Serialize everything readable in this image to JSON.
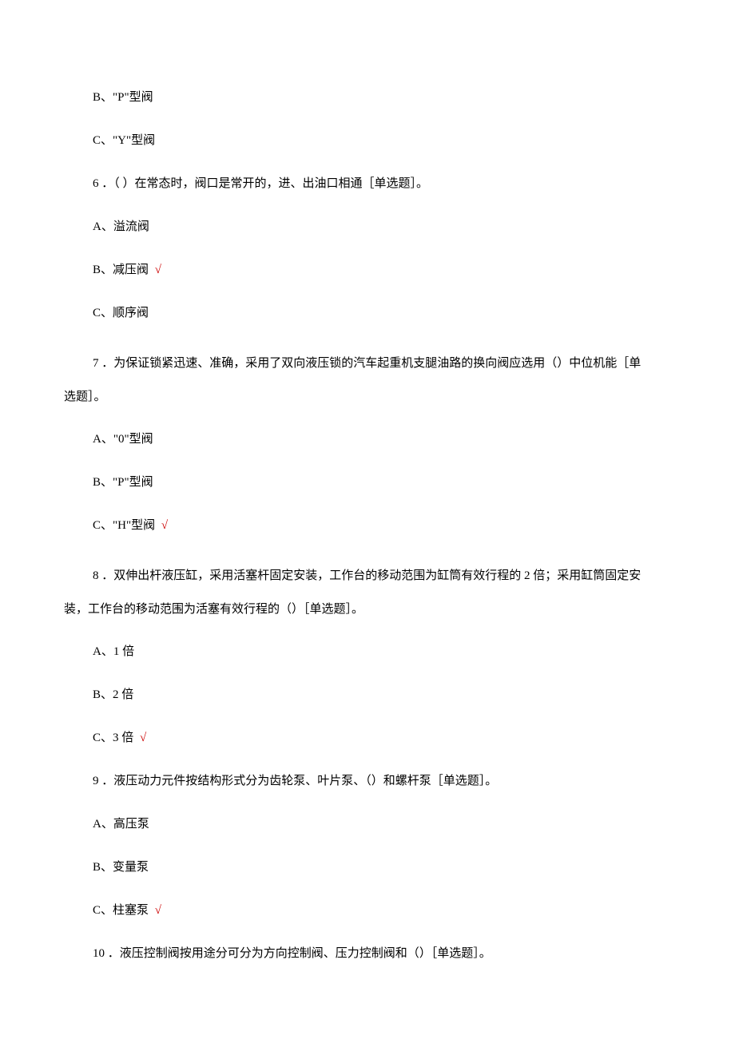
{
  "options": {
    "q5_b": "B、\"P\"型阀",
    "q5_c": "C、\"Y\"型阀",
    "q6_a": "A、溢流阀",
    "q6_b": "B、减压阀",
    "q6_c": "C、顺序阀",
    "q7_a": "A、\"0\"型阀",
    "q7_b": "B、\"P\"型阀",
    "q7_c": "C、\"H\"型阀",
    "q8_a": "A、1 倍",
    "q8_b": "B、2 倍",
    "q8_c": "C、3 倍",
    "q9_a": "A、高压泵",
    "q9_b": "B、变量泵",
    "q9_c": "C、柱塞泵"
  },
  "questions": {
    "q6": {
      "num": "6",
      "text": "．（ ）在常态时，阀口是常开的，进、出油口相通［单选题］。"
    },
    "q7": {
      "num": "7",
      "text_part1": "．为保证锁紧迅速、准确，采用了双向液压锁的汽车起重机支腿油路的换向阀应选用（）中位机能［单",
      "text_part2": "选题］。"
    },
    "q8": {
      "num": "8",
      "text_part1": "．双伸出杆液压缸，采用活塞杆固定安装，工作台的移动范围为缸筒有效行程的 2 倍；采用缸筒固定安",
      "text_part2": "装，工作台的移动范围为活塞有效行程的（）［单选题］。"
    },
    "q9": {
      "num": "9",
      "text": "．液压动力元件按结构形式分为齿轮泵、叶片泵、（）和螺杆泵［单选题］。"
    },
    "q10": {
      "num": "10",
      "text": "．液压控制阀按用途分可分为方向控制阀、压力控制阀和（）［单选题］。"
    }
  },
  "checkmark": "√"
}
